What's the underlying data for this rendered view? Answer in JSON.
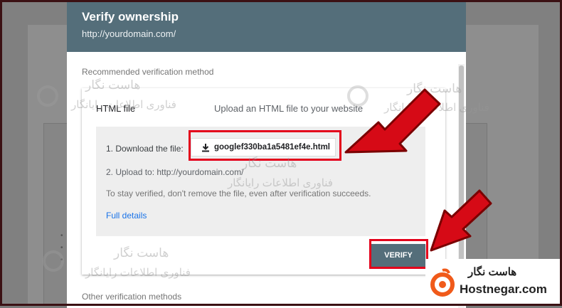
{
  "dialog": {
    "title": "Verify ownership",
    "subtitle": "http://yourdomain.com/"
  },
  "recommended_label": "Recommended verification method",
  "method": {
    "title": "HTML file",
    "description": "Upload an HTML file to your website",
    "step1_label": "1. Download the file:",
    "file_name": "googlef330ba1a5481ef4e.html",
    "step2": "2. Upload to: http://yourdomain.com/",
    "note": "To stay verified, don't remove the file, even after verification succeeds.",
    "details_link": "Full details",
    "verify_label": "VERIFY"
  },
  "other_label": "Other verification methods",
  "watermark": {
    "line1": "هاست نگار",
    "line2": "فناوری اطلاعات رایانگار"
  },
  "brand": {
    "name": "هاست نگار",
    "domain": "Hostnegar.com"
  },
  "colors": {
    "header": "#546e7a",
    "highlight": "#e3001b",
    "link": "#1a73e8",
    "brand_orange": "#f05a1a"
  },
  "icons": [
    "download-icon",
    "chevron-up-icon",
    "brand-logo-icon",
    "red-arrow-icon"
  ]
}
